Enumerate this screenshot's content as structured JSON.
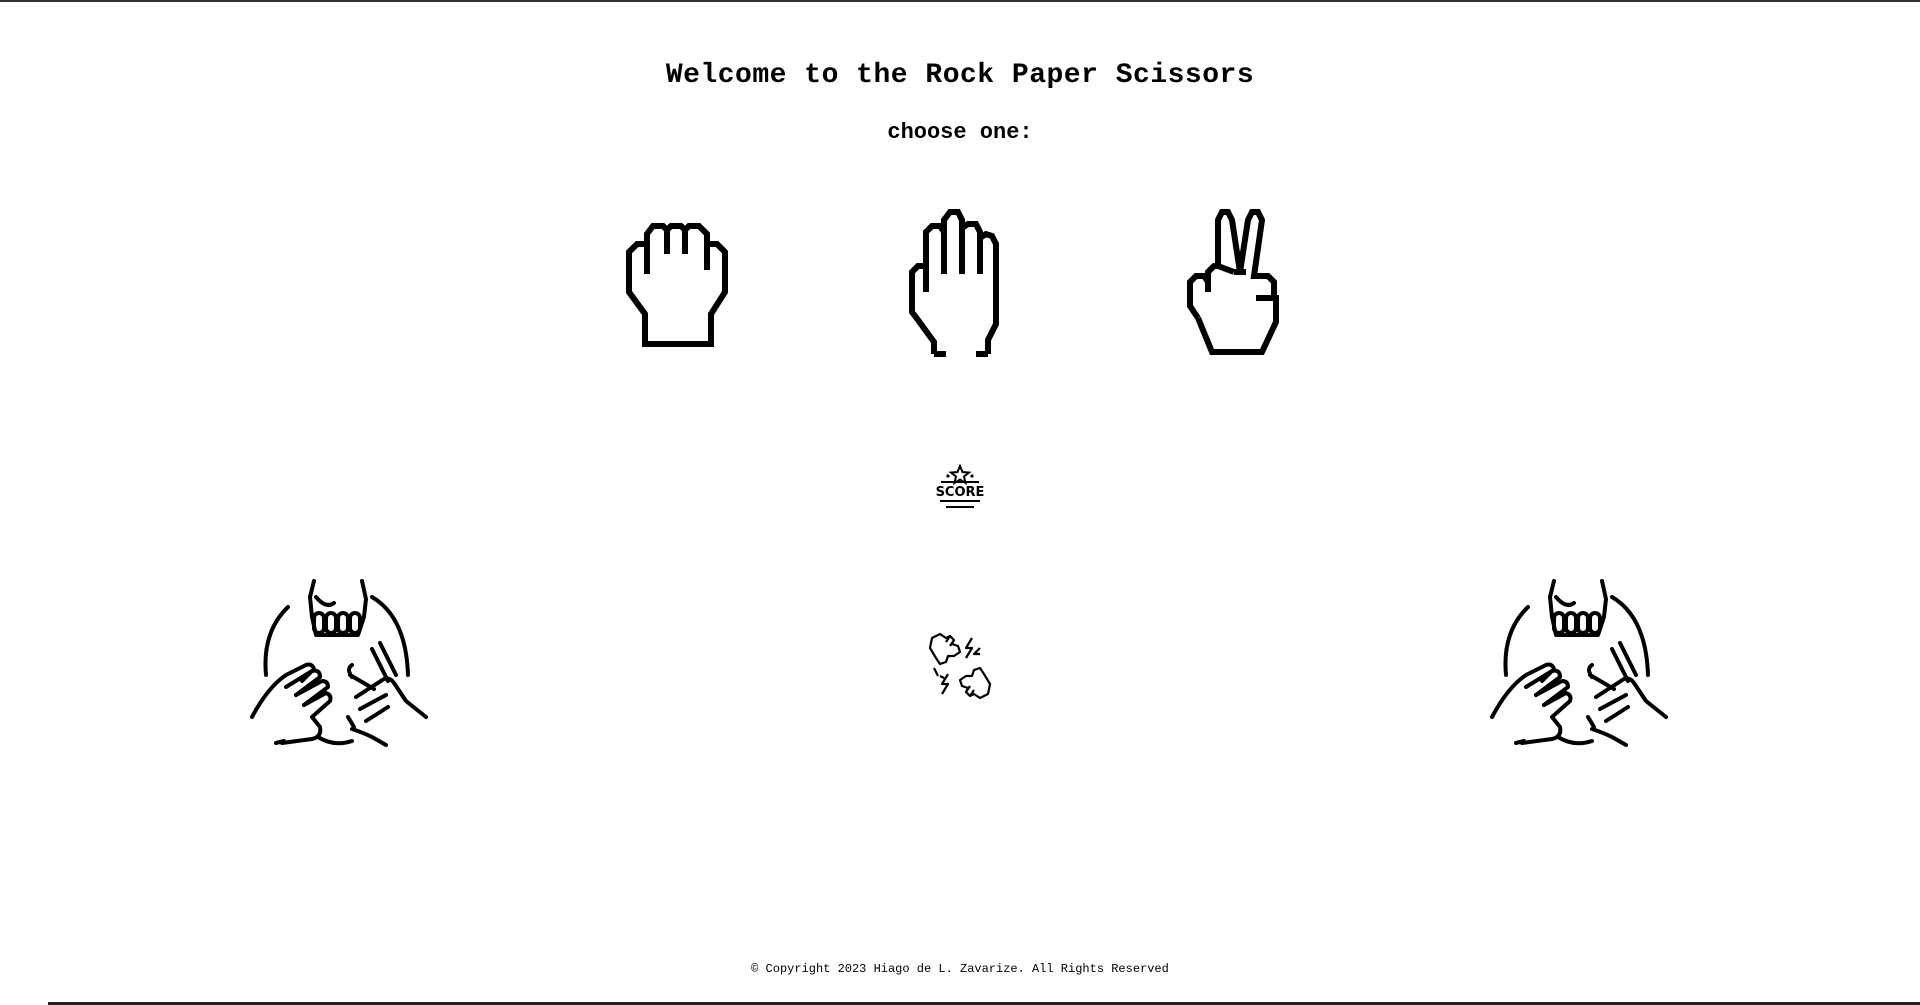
{
  "header": {
    "title": "Welcome to the Rock Paper Scissors",
    "subtitle": "choose one:"
  },
  "choices": [
    {
      "name": "rock",
      "icon": "rock-hand-icon"
    },
    {
      "name": "paper",
      "icon": "paper-hand-icon"
    },
    {
      "name": "scissors",
      "icon": "scissors-hand-icon"
    }
  ],
  "scoreboard": {
    "icon": "score-icon",
    "label": "SCORE"
  },
  "versus": {
    "icon": "fist-bump-versus-icon"
  },
  "players": [
    {
      "side": "left",
      "icon": "rock-paper-scissors-hands-icon"
    },
    {
      "side": "right",
      "icon": "rock-paper-scissors-hands-icon"
    }
  ],
  "footer": {
    "copyright": "© Copyright 2023 Hiago de L. Zavarize. All Rights Reserved"
  },
  "colors": {
    "background": "#ffffff",
    "foreground": "#000000"
  }
}
